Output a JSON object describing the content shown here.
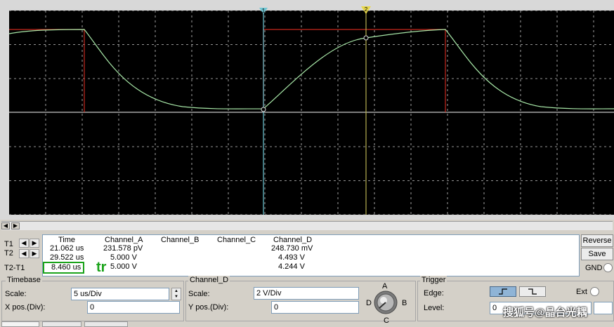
{
  "colors": {
    "screen_bg": "#000000",
    "grid": "#c8c8c8",
    "trace": "#a8e8a8",
    "square": "#c8281e",
    "cursor_t1": "#6fc7d4",
    "cursor_t2": "#b8b050",
    "highlight": "#1aa31a"
  },
  "cursors": {
    "t1_marker": "1",
    "t2_marker": "2"
  },
  "readout": {
    "headers": {
      "time": "Time",
      "channel_a": "Channel_A",
      "channel_b": "Channel_B",
      "channel_c": "Channel_C",
      "channel_d": "Channel_D"
    },
    "rows": [
      {
        "label": "T1",
        "time": "21.062 us",
        "channel_a": "231.578 pV",
        "channel_d": "248.730 mV"
      },
      {
        "label": "T2",
        "time": "29.522 us",
        "channel_a": "5.000 V",
        "channel_d": "4.493 V"
      },
      {
        "label": "T2-T1",
        "time": "8.460 us",
        "channel_a": "5.000 V",
        "channel_d": "4.244 V"
      }
    ],
    "annotation": "tr"
  },
  "buttons": {
    "reverse": "Reverse",
    "save": "Save",
    "gnd": "GND"
  },
  "timebase": {
    "title": "Timebase",
    "scale_label": "Scale:",
    "scale_value": "5 us/Div",
    "xpos_label": "X pos.(Div):",
    "xpos_value": "0"
  },
  "channel_d": {
    "title": "Channel_D",
    "scale_label": "Scale:",
    "scale_value": "2  V/Div",
    "ypos_label": "Y pos.(Div):",
    "ypos_value": "0"
  },
  "selector": {
    "a": "A",
    "b": "B",
    "c": "C",
    "d": "D"
  },
  "trigger": {
    "title": "Trigger",
    "edge_label": "Edge:",
    "level_label": "Level:",
    "level_value": "0",
    "ext_label": "Ext",
    "rising_icon": "rising-edge",
    "falling_icon": "falling-edge"
  },
  "watermark": "搜狐号@晶台光耦"
}
